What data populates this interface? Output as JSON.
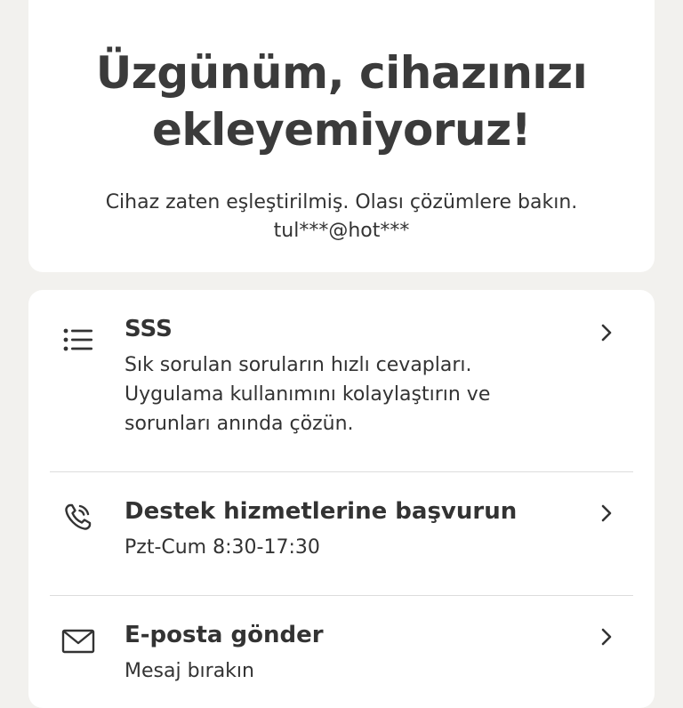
{
  "header": {
    "title_line1": "Üzgünüm, cihazınızı",
    "title_line2": "ekleyemiyoruz!",
    "message": "Cihaz zaten eşleştirilmiş. Olası çözümlere bakın.",
    "account": "tul***@hot***"
  },
  "options": [
    {
      "icon": "list-icon",
      "title": "SSS",
      "desc_lines": [
        "Sık sorulan soruların hızlı cevapları.",
        "Uygulama kullanımını kolaylaştırın ve",
        "sorunları anında çözün."
      ]
    },
    {
      "icon": "phone-icon",
      "title": "Destek hizmetlerine başvurun",
      "desc_lines": [
        "Pzt-Cum 8:30-17:30"
      ]
    },
    {
      "icon": "mail-icon",
      "title": "E-posta gönder",
      "desc_lines": [
        "Mesaj bırakın"
      ]
    }
  ]
}
